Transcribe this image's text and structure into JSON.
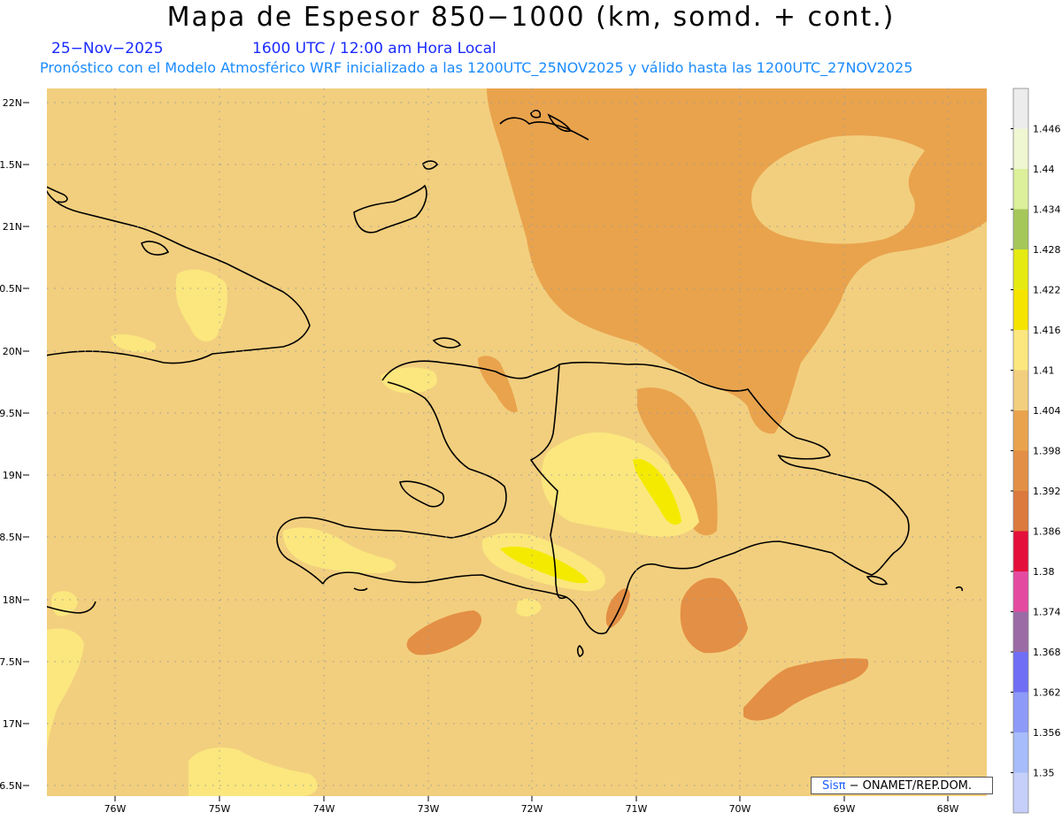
{
  "header": {
    "title": "Mapa de Espesor 850−1000 (km, somd. + cont.)",
    "date": "25−Nov−2025",
    "time": "1600 UTC / 12:00 am Hora Local",
    "subtitle": "Pronóstico con el Modelo Atmosférico WRF inicializado a las 1200UTC_25NOV2025 y válido hasta las  1200UTC_27NOV2025"
  },
  "map": {
    "lat_labels": [
      "22N",
      "1.5N",
      "21N",
      "0.5N",
      "20N",
      "9.5N",
      "19N",
      "8.5N",
      "18N",
      "7.5N",
      "17N",
      "6.5N"
    ],
    "lon_labels": [
      "76W",
      "75W",
      "74W",
      "73W",
      "72W",
      "71W",
      "70W",
      "69W",
      "68W"
    ],
    "colors": {
      "base": "#f2cf7e",
      "orange": "#e9a34d",
      "dark_orange": "#e38f45",
      "light_yellow": "#fbe77e",
      "yellow": "#f4ea00"
    }
  },
  "colorbar": {
    "labels": [
      "1.446",
      "1.44",
      "1.434",
      "1.428",
      "1.422",
      "1.416",
      "1.41",
      "1.404",
      "1.398",
      "1.392",
      "1.386",
      "1.38",
      "1.374",
      "1.368",
      "1.362",
      "1.356",
      "1.35"
    ],
    "colors": [
      "#ececec",
      "#eff6d2",
      "#dcef9a",
      "#a5c75a",
      "#e5ea11",
      "#f5e400",
      "#fbe77e",
      "#f2cf7e",
      "#e9a34d",
      "#e38f45",
      "#dc793d",
      "#e40f3b",
      "#e44aa0",
      "#9b6ba6",
      "#6f6ef5",
      "#8e9af8",
      "#a7bcfa",
      "#c5cffa"
    ]
  },
  "credit": {
    "logo": "Sisπ",
    "text": "− ONAMET/REP.DOM."
  }
}
